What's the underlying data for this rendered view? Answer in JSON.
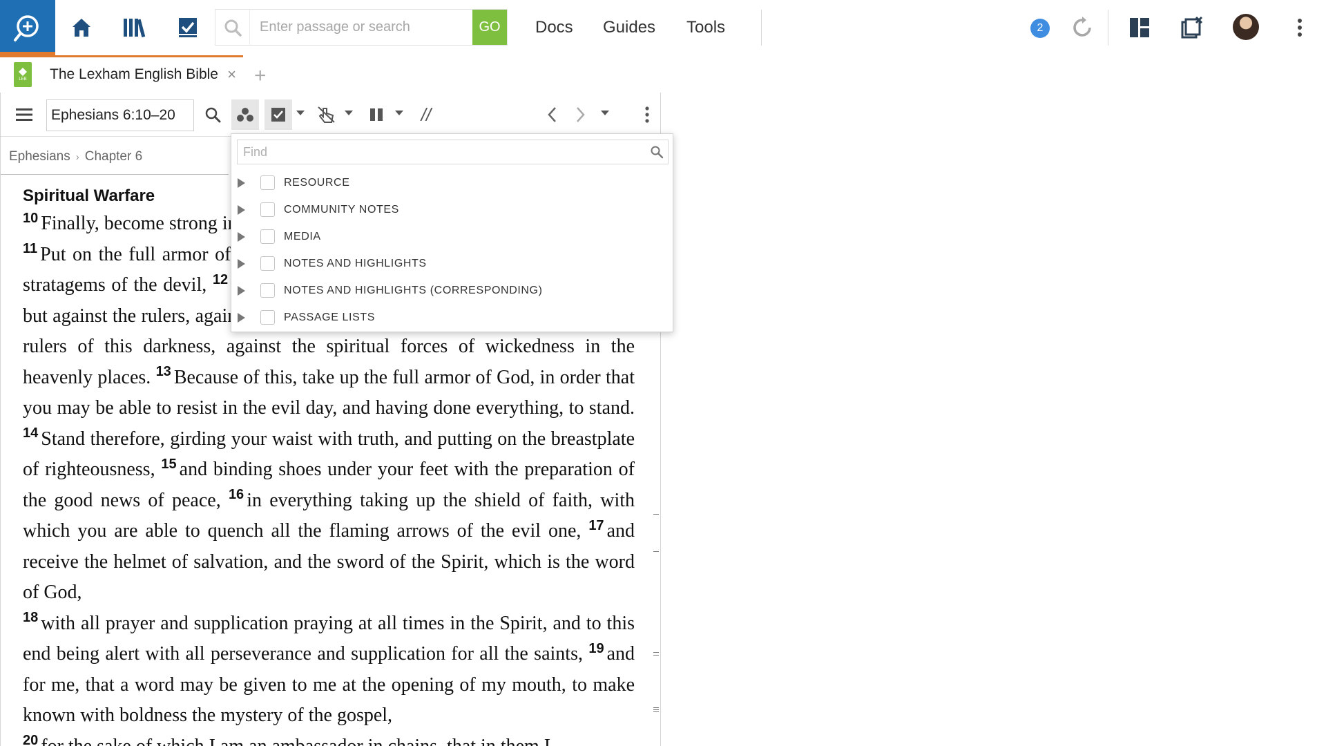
{
  "topbar": {
    "search_placeholder": "Enter passage or search",
    "go_label": "GO",
    "links": [
      "Docs",
      "Guides",
      "Tools"
    ],
    "notification_count": "2",
    "icons": [
      "logos-search-icon",
      "home-icon",
      "library-icon",
      "checklist-icon",
      "sync-icon",
      "layout-icon",
      "close-panels-icon",
      "avatar",
      "more-vertical-icon"
    ]
  },
  "tab": {
    "title": "The Lexham English Bible",
    "close_glyph": "×",
    "add_glyph": "+",
    "icon_text": "LEB"
  },
  "toolbar": {
    "reference": "Ephesians 6:10–20",
    "parallel_glyph": "//"
  },
  "breadcrumb": {
    "book": "Ephesians",
    "separator": "›",
    "chapter": "Chapter 6"
  },
  "content": {
    "heading": "Spiritual Warfare",
    "verses": [
      {
        "n": "10",
        "text": "Finally, become strong in the Lord and in the strength of his might."
      },
      {
        "n": "11",
        "text": "Put on the full armor of God, so that you may be able to stand against the stratagems of the devil,"
      },
      {
        "n": "12",
        "text": "because our struggle is not against blood and flesh, but against the rulers, against the authorities, against the cosmic powers, world rulers of this darkness, against the spiritual forces of wickedness in the heavenly places."
      },
      {
        "n": "13",
        "text": "Because of this, take up the full armor of God, in order that you may be able to resist in the evil day, and having done everything, to stand."
      },
      {
        "n": "14",
        "text": "Stand therefore, girding your waist with truth, and putting on the breastplate of righteousness,"
      },
      {
        "n": "15",
        "text": "and binding shoes under your feet with the preparation of the good news of peace,"
      },
      {
        "n": "16",
        "text": "in everything taking up the shield of faith, with which you are able to quench all the flaming arrows of the evil one,"
      },
      {
        "n": "17",
        "text": "and receive the helmet of salvation, and the sword of the Spirit, which is the word of God,"
      },
      {
        "n": "18",
        "text": "with all prayer and supplication praying at all times in the Spirit, and to this end being alert with all perseverance and supplication for all the saints,"
      },
      {
        "n": "19",
        "text": "and for me, that a word may be given to me at the opening of my mouth, to make known with boldness the mystery of the gospel,"
      },
      {
        "n": "20",
        "text": "for the sake of which I am an ambassador in chains, that in them I"
      }
    ]
  },
  "popup": {
    "find_placeholder": "Find",
    "items": [
      "RESOURCE",
      "COMMUNITY NOTES",
      "MEDIA",
      "NOTES AND HIGHLIGHTS",
      "NOTES AND HIGHLIGHTS (CORRESPONDING)",
      "PASSAGE LISTS"
    ]
  },
  "colors": {
    "logo_bg": "#1f6fb5",
    "accent_orange": "#e07a2e",
    "go_green": "#7fbf3f",
    "badge_blue": "#3f8de0"
  }
}
